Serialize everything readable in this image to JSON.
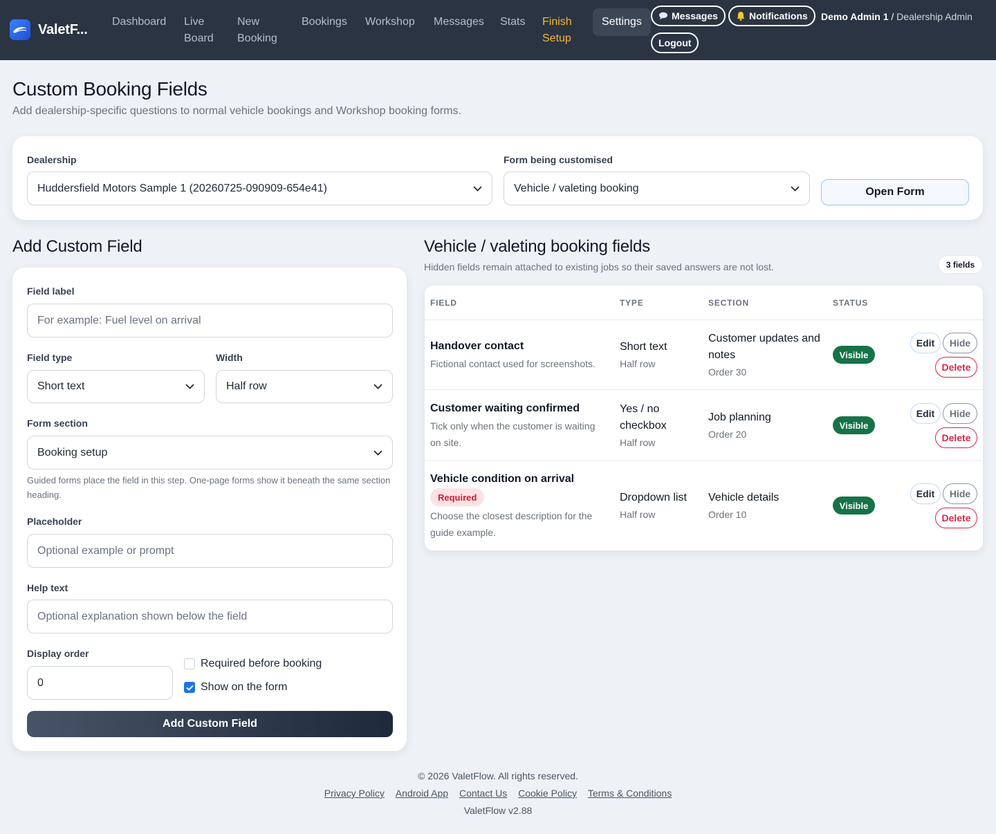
{
  "nav": {
    "brand": "ValetF...",
    "links": {
      "dashboard": "Dashboard",
      "live1": "Live",
      "live2": "Board",
      "new1": "New",
      "new2": "Booking",
      "bookings": "Bookings",
      "workshop": "Workshop",
      "messages": "Messages",
      "stats": "Stats",
      "finish1": "Finish",
      "finish2": "Setup",
      "settings": "Settings"
    },
    "messages_btn": "Messages",
    "notifications_btn": "Notifications",
    "logout_btn": "Logout",
    "user_name": "Demo Admin 1",
    "user_sep": " / ",
    "user_role": "Dealership Admin"
  },
  "header": {
    "title": "Custom Booking Fields",
    "subtitle": "Add dealership-specific questions to normal vehicle bookings and Workshop booking forms."
  },
  "selector": {
    "dealership_label": "Dealership",
    "dealership_value": "Huddersfield Motors Sample 1 (20260725-090909-654e41)",
    "form_label": "Form being customised",
    "form_value": "Vehicle / valeting booking",
    "open_form": "Open Form"
  },
  "add_field": {
    "title": "Add Custom Field",
    "field_label": "Field label",
    "field_label_placeholder": "For example: Fuel level on arrival",
    "field_type_label": "Field type",
    "field_type_value": "Short text",
    "width_label": "Width",
    "width_value": "Half row",
    "section_label": "Form section",
    "section_value": "Booking setup",
    "section_help": "Guided forms place the field in this step. One-page forms show it beneath the same section heading.",
    "placeholder_label": "Placeholder",
    "placeholder_placeholder": "Optional example or prompt",
    "help_label": "Help text",
    "help_placeholder": "Optional explanation shown below the field",
    "order_label": "Display order",
    "order_value": "0",
    "required_label": "Required before booking",
    "required_checked": false,
    "show_label": "Show on the form",
    "show_checked": true,
    "submit": "Add Custom Field"
  },
  "fields_list": {
    "title": "Vehicle / valeting booking fields",
    "subtitle": "Hidden fields remain attached to existing jobs so their saved answers are not lost.",
    "count": "3 fields",
    "columns": [
      "FIELD",
      "TYPE",
      "SECTION",
      "STATUS"
    ],
    "rows": [
      {
        "name": "Handover contact",
        "required": "",
        "desc": "Fictional contact used for screenshots.",
        "type": "Short text",
        "width": "Half row",
        "section": "Customer updates and notes",
        "order": "Order 30",
        "status": "Visible"
      },
      {
        "name": "Customer waiting confirmed",
        "required": "",
        "desc": "Tick only when the customer is waiting on site.",
        "type": "Yes / no checkbox",
        "width": "Half row",
        "section": "Job planning",
        "order": "Order 20",
        "status": "Visible"
      },
      {
        "name": "Vehicle condition on arrival",
        "required": "Required",
        "desc": "Choose the closest description for the guide example.",
        "type": "Dropdown list",
        "width": "Half row",
        "section": "Vehicle details",
        "order": "Order 10",
        "status": "Visible"
      }
    ],
    "actions": {
      "edit": "Edit",
      "hide": "Hide",
      "delete": "Delete"
    }
  },
  "footer": {
    "copyright": "© 2026 ValetFlow. All rights reserved.",
    "links": [
      "Privacy Policy",
      "Android App",
      "Contact Us",
      "Cookie Policy",
      "Terms & Conditions"
    ],
    "version": "ValetFlow v2.88"
  },
  "colors": {
    "nav_bg": "#2b3442",
    "finish_accent": "#f5b82e",
    "visible_badge": "#157347",
    "delete_red": "#dc2645",
    "checkbox_blue": "#1a73e8"
  }
}
